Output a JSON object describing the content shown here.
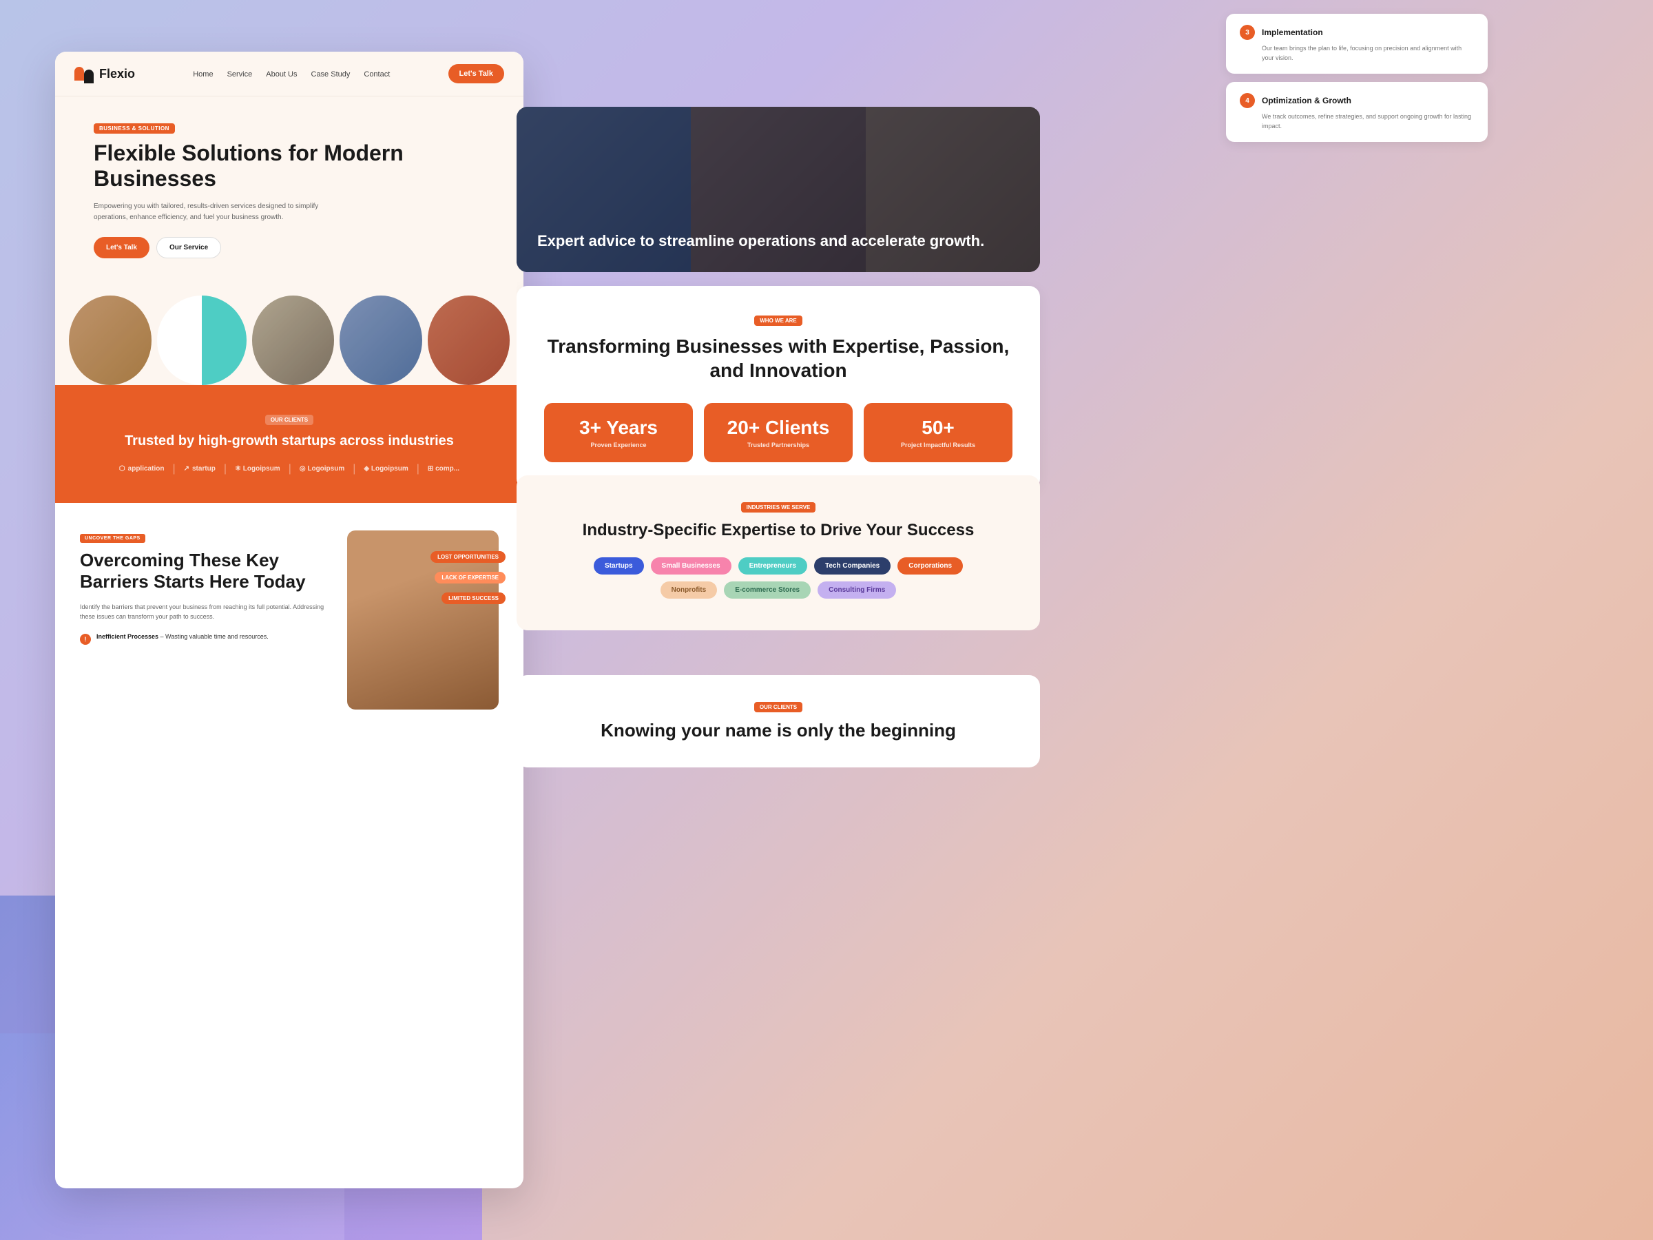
{
  "background": {
    "gradient": "linear-gradient(135deg, #b8c4e8, #c4b8e8, #e8c4b8, #e8b8a0)"
  },
  "left_panel": {
    "nav": {
      "logo_text": "Flexio",
      "links": [
        "Home",
        "Service",
        "About Us",
        "Case Study",
        "Contact"
      ],
      "cta_label": "Let's Talk"
    },
    "hero": {
      "badge": "BUSINESS & SOLUTION",
      "title": "Flexible Solutions for Modern Businesses",
      "subtitle": "Empowering you with tailored, results-driven services designed to simplify operations, enhance efficiency, and fuel your business growth.",
      "btn_primary": "Let's Talk",
      "btn_secondary": "Our Service"
    },
    "orange_section": {
      "badge": "OUR CLIENTS",
      "title": "Trusted by high-growth startups across industries",
      "logos": [
        "application",
        "startup",
        "Logoipsum",
        "Logoipsum",
        "Logoipsum",
        "comp..."
      ]
    },
    "barriers": {
      "badge": "UNCOVER THE GAPS",
      "title": "Overcoming These Key Barriers Starts Here Today",
      "subtitle": "Identify the barriers that prevent your business from reaching its full potential. Addressing these issues can transform your path to success.",
      "items": [
        {
          "label": "Inefficient Processes",
          "desc": "Wasting valuable time and resources."
        }
      ],
      "tags": [
        "LOST OPPORTUNITIES",
        "LACK OF EXPERTISE",
        "LIMITED SUCCESS"
      ]
    }
  },
  "right_panel": {
    "process": {
      "cards": [
        {
          "step": "3",
          "title": "Implementation",
          "desc": "Our team brings the plan to life, focusing on precision and alignment with your vision."
        },
        {
          "step": "4",
          "title": "Optimization & Growth",
          "desc": "We track outcomes, refine strategies, and support ongoing growth for lasting impact."
        }
      ]
    },
    "banner": {
      "text": "Expert advice to streamline operations and accelerate growth."
    },
    "who_we_are": {
      "badge": "WHO WE ARE",
      "title": "Transforming Businesses with Expertise, Passion, and Innovation",
      "stats": [
        {
          "num": "3+ Years",
          "label": "Proven Experience"
        },
        {
          "num": "20+ Clients",
          "label": "Trusted Partnerships"
        },
        {
          "num": "50+",
          "label": "Project Impactful Results"
        }
      ]
    },
    "industries": {
      "badge": "INDUSTRIES WE SERVE",
      "title": "Industry-Specific Expertise to Drive Your Success",
      "tags": [
        {
          "label": "Startups",
          "color": "blue"
        },
        {
          "label": "Small Businesses",
          "color": "pink"
        },
        {
          "label": "Entrepreneurs",
          "color": "teal"
        },
        {
          "label": "Tech Companies",
          "color": "dark"
        },
        {
          "label": "Corporations",
          "color": "coral"
        },
        {
          "label": "Nonprofits",
          "color": "peach"
        },
        {
          "label": "E-commerce Stores",
          "color": "sage"
        },
        {
          "label": "Consulting Firms",
          "color": "lavender"
        }
      ]
    },
    "clients": {
      "badge": "OUR CLIENTS",
      "title": "Knowing your name is only the beginning"
    }
  }
}
